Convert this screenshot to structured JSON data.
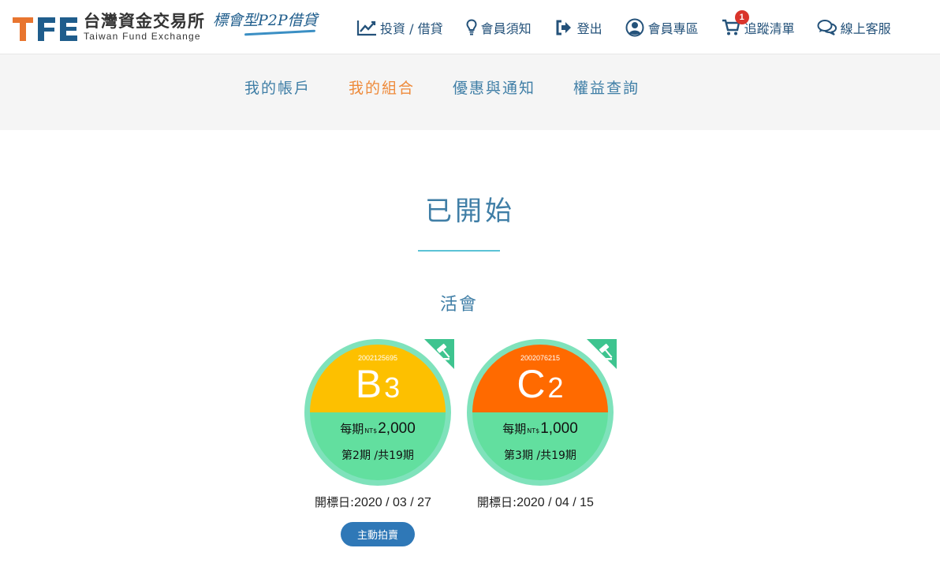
{
  "brand": {
    "name_zh": "台灣資金交易所",
    "name_en": "Taiwan Fund Exchange",
    "slogan": "標會型P2P借貸"
  },
  "nav": [
    {
      "label": "投資 / 借貸",
      "icon": "line-chart-icon"
    },
    {
      "label": "會員須知",
      "icon": "lightbulb-icon"
    },
    {
      "label": "登出",
      "icon": "sign-out-icon"
    },
    {
      "label": "會員專區",
      "icon": "user-circle-icon"
    },
    {
      "label": "追蹤清單",
      "icon": "cart-icon",
      "badge": "1"
    },
    {
      "label": "線上客服",
      "icon": "chat-icon"
    }
  ],
  "subnav": [
    {
      "label": "我的帳戶",
      "active": false
    },
    {
      "label": "我的組合",
      "active": true
    },
    {
      "label": "優惠與通知",
      "active": false
    },
    {
      "label": "權益查詢",
      "active": false
    }
  ],
  "page_title": "已開始",
  "section_title": "活會",
  "cards": [
    {
      "id": "2002125695",
      "letter": "B",
      "number": "3",
      "top_color": "#fdc000",
      "per_label": "每期",
      "per_unit": "NT$",
      "per_amount": "2,000",
      "period": "第2期 /共19期",
      "open_label": "開標日:",
      "open_date": "2020 / 03 / 27",
      "button": "主動拍賣"
    },
    {
      "id": "2002076215",
      "letter": "C",
      "number": "2",
      "top_color": "#ff6a00",
      "per_label": "每期",
      "per_unit": "NT$",
      "per_amount": "1,000",
      "period": "第3期 /共19期",
      "open_label": "開標日:",
      "open_date": "2020 / 04 / 15"
    }
  ],
  "colors": {
    "primary_blue": "#3f7ea6",
    "nav_blue": "#24527a",
    "active_orange": "#ee8a3a",
    "ring_green": "#7fe2bb",
    "bottom_green": "#62df9f",
    "button_blue": "#2f78b7"
  }
}
